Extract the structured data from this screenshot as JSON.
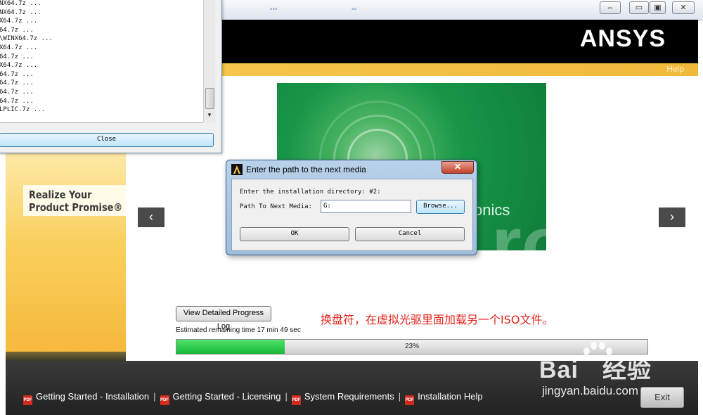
{
  "log_window": {
    "lines": [
      "NX64.7z ...",
      "NX64.7z ...",
      "X64.7z ...",
      "64.7z ...",
      "\\WINX64.7z ...",
      "X64.7z ...",
      "64.7z ...",
      "X64.7z ...",
      "64.7z ...",
      "64.7z ...",
      "64.7z ...",
      "64.7z ...",
      "LPLIC.7z ..."
    ],
    "close_label": "Close"
  },
  "installer": {
    "logo": "ANSYS",
    "help_label": "Help",
    "promo_line1": "Realize Your",
    "promo_line2": "Product Promise®",
    "banner_text": "onics",
    "banner_bg_text": "ro",
    "nav_prev": "‹",
    "nav_next": "›",
    "view_log_label": "View Detailed Progress Log",
    "remaining_text": "Estimated remaining time 17 min 49 sec",
    "progress_percent": 23,
    "progress_label": "23%",
    "annotation": "换盘符，在虚拟光驱里面加载另一个ISO文件。",
    "exit_label": "Exit",
    "accent_color": "#f6c54b",
    "progress_color": "#17b737"
  },
  "footer": {
    "links": [
      "Getting Started - Installation",
      "Getting Started - Licensing",
      "System Requirements",
      "Installation Help"
    ],
    "pdf_icon": "PDF"
  },
  "dialog": {
    "title": "Enter the path to the next media",
    "close_glyph": "✕",
    "instruction": "Enter the installation directory: #2:",
    "path_label": "Path To Next Media:",
    "path_value": "G:",
    "browse_label": "Browse...",
    "ok_label": "OK",
    "cancel_label": "Cancel"
  },
  "watermark": {
    "brand": "Bai",
    "brand2": "经验",
    "url": "jingyan.baidu.com"
  }
}
